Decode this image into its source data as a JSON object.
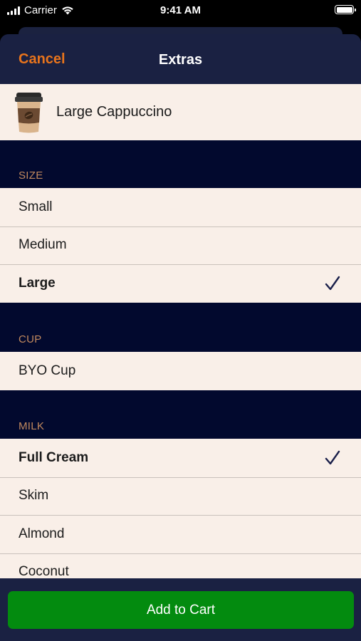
{
  "status_bar": {
    "carrier": "Carrier",
    "time": "9:41 AM"
  },
  "nav": {
    "cancel_label": "Cancel",
    "title": "Extras"
  },
  "product": {
    "name": "Large Cappuccino",
    "image_icon": "coffee-cup-icon"
  },
  "sections": {
    "size": {
      "header": "SIZE",
      "options": [
        {
          "label": "Small",
          "selected": false
        },
        {
          "label": "Medium",
          "selected": false
        },
        {
          "label": "Large",
          "selected": true
        }
      ]
    },
    "cup": {
      "header": "CUP",
      "options": [
        {
          "label": "BYO Cup",
          "selected": false
        }
      ]
    },
    "milk": {
      "header": "MILK",
      "options": [
        {
          "label": "Full Cream",
          "selected": true
        },
        {
          "label": "Skim",
          "selected": false
        },
        {
          "label": "Almond",
          "selected": false
        },
        {
          "label": "Coconut",
          "selected": false
        }
      ]
    }
  },
  "footer": {
    "add_to_cart_label": "Add to Cart"
  },
  "colors": {
    "accent": "#e8741c",
    "nav_background": "#1a2142",
    "page_background": "#02092e",
    "row_background": "#f9efe8",
    "section_header": "#c2895e",
    "button": "#038b0f",
    "checkmark": "#1a1f4a"
  }
}
